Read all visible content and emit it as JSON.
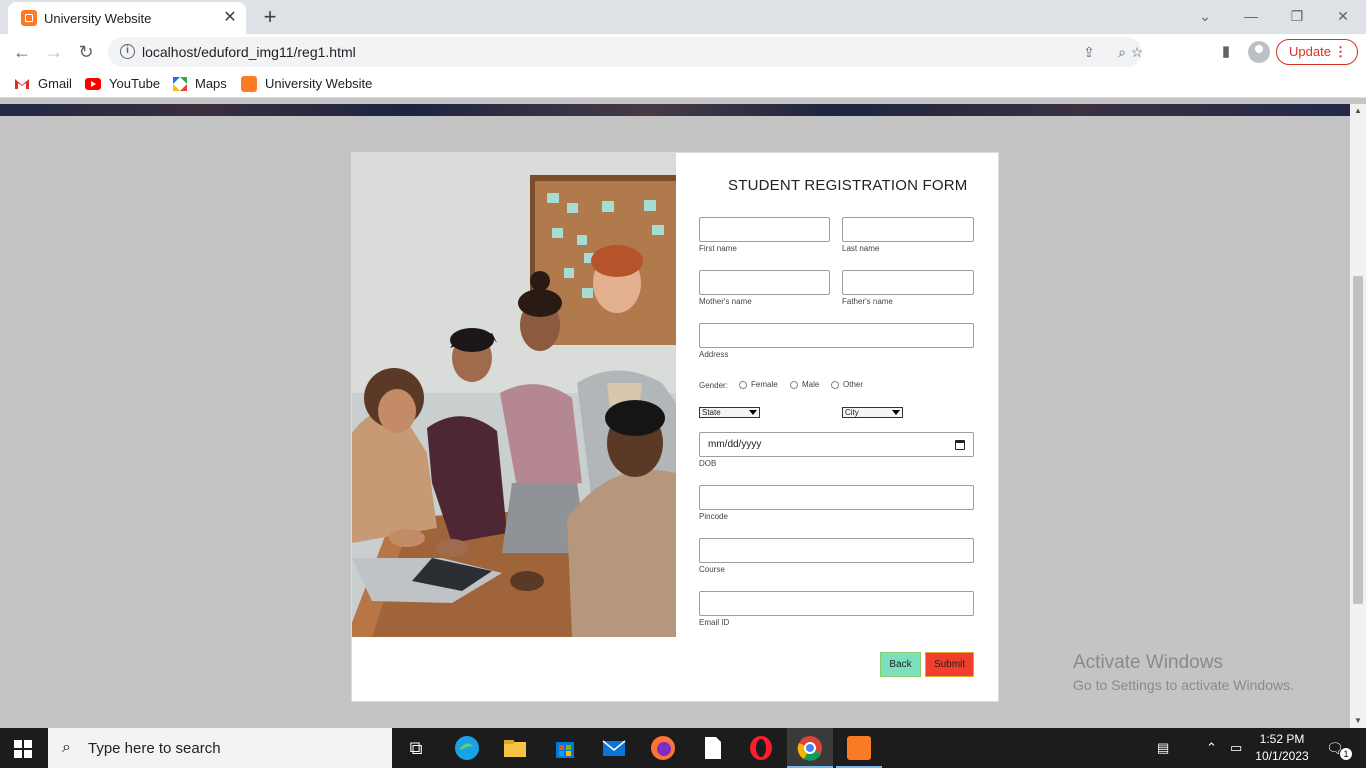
{
  "browser": {
    "tab_title": "University Website",
    "url": "localhost/eduford_img11/reg1.html",
    "update_label": "Update",
    "bookmarks": [
      {
        "label": "Gmail",
        "icon": "gmail-icon"
      },
      {
        "label": "YouTube",
        "icon": "youtube-icon"
      },
      {
        "label": "Maps",
        "icon": "maps-icon"
      },
      {
        "label": "University Website",
        "icon": "xampp-icon"
      }
    ]
  },
  "form": {
    "title": "STUDENT REGISTRATION FORM",
    "first_name_label": "First name",
    "last_name_label": "Last name",
    "mother_label": "Mother's name",
    "father_label": "Father's name",
    "address_label": "Address",
    "gender_label": "Gender:",
    "gender_options": [
      "Female",
      "Male",
      "Other"
    ],
    "state_value": "State",
    "city_value": "City",
    "dob_placeholder": "mm/dd/yyyy",
    "dob_label": "DOB",
    "pincode_label": "Pincode",
    "course_label": "Course",
    "email_label": "Email ID",
    "back_label": "Back",
    "submit_label": "Submit"
  },
  "watermark": {
    "line1": "Activate Windows",
    "line2": "Go to Settings to activate Windows."
  },
  "taskbar": {
    "search_placeholder": "Type here to search",
    "time": "1:52 PM",
    "date": "10/1/2023",
    "notification_count": "1"
  },
  "colors": {
    "page_bg": "#c4c4c4",
    "back_button": "#7ce0bf",
    "submit_button": "#f23e2c",
    "update_accent": "#d93025"
  }
}
